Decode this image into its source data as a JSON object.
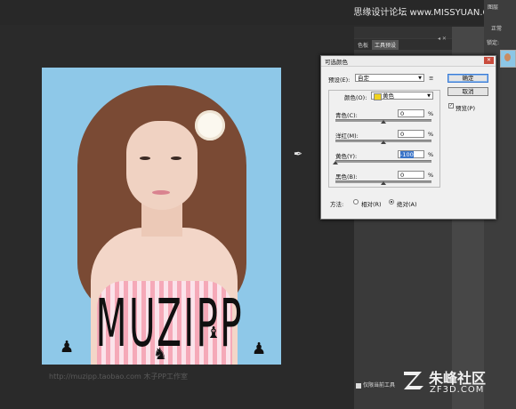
{
  "watermark_top": "思缘设计论坛 www.MISSYUAN.COM",
  "right_tabs": [
    "图层",
    "正常",
    "锁定:"
  ],
  "panel_tabs": [
    "色板",
    "工具预设"
  ],
  "panel_close": "◂ ✕",
  "footer_checkbox": "仅限当前工具",
  "brand": {
    "name": "朱峰社区",
    "domain": "ZF3D.COM"
  },
  "canvas": {
    "overlay_text": "MUZIPP",
    "url": "http://muzipp.taobao.com 木子PP工作室"
  },
  "dialog": {
    "title": "可选颜色",
    "close": "✕",
    "preset_label": "预设(E):",
    "preset_value": "自定",
    "preset_menu_icon": "≡",
    "colors_label": "颜色(O):",
    "colors_value": "黄色",
    "colors_swatch": "#f0d21f",
    "sliders": [
      {
        "label": "青色(C):",
        "value": "0",
        "unit": "%",
        "knob_pct": 0.5
      },
      {
        "label": "洋红(M):",
        "value": "0",
        "unit": "%",
        "knob_pct": 0.5
      },
      {
        "label": "黄色(Y):",
        "value": "-100",
        "unit": "%",
        "knob_pct": 0.0
      },
      {
        "label": "黑色(B):",
        "value": "0",
        "unit": "%",
        "knob_pct": 0.5
      }
    ],
    "method_label": "方法:",
    "method_options": [
      "相对(R)",
      "绝对(A)"
    ],
    "method_selected": "绝对(A)",
    "ok": "确定",
    "cancel": "取消",
    "preview_label": "预览(P)",
    "preview_checked": true
  }
}
